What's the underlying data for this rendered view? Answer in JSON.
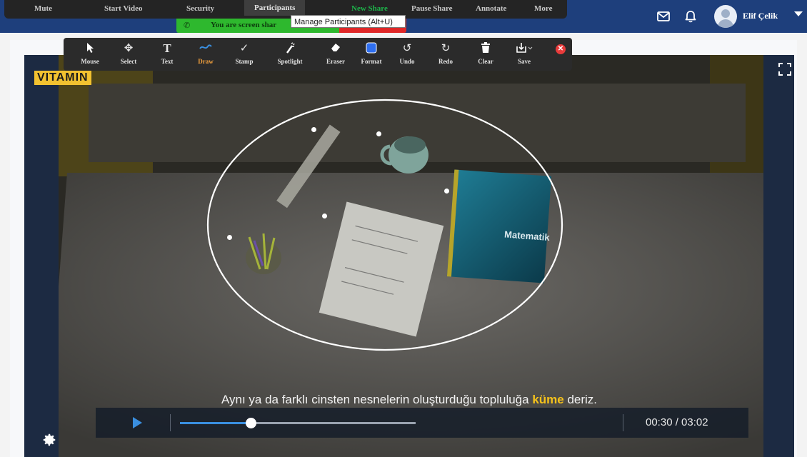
{
  "meeting_menu": [
    {
      "label": "Mute"
    },
    {
      "label": "Start Video"
    },
    {
      "label": "Security"
    },
    {
      "label": "Participants"
    },
    {
      "label": "New Share"
    },
    {
      "label": "Pause Share"
    },
    {
      "label": "Annotate"
    },
    {
      "label": "More"
    }
  ],
  "share_banner": {
    "text": "You are screen shar",
    "phone_icon": "phone-icon"
  },
  "tooltip": "Manage Participants (Alt+U)",
  "header": {
    "icons": [
      "mail-icon",
      "bell-icon"
    ],
    "user_name": "Elif Çelik"
  },
  "annotation_toolbar": [
    {
      "label": "Mouse",
      "icon": "cursor-icon"
    },
    {
      "label": "Select",
      "icon": "move-icon"
    },
    {
      "label": "Text",
      "icon": "text-icon"
    },
    {
      "label": "Draw",
      "icon": "draw-icon",
      "active": true
    },
    {
      "label": "Stamp",
      "icon": "check-icon"
    },
    {
      "label": "Spotlight",
      "icon": "spotlight-icon"
    },
    {
      "label": "Eraser",
      "icon": "eraser-icon"
    },
    {
      "label": "Format",
      "icon": "format-icon"
    },
    {
      "label": "Undo",
      "icon": "undo-icon"
    },
    {
      "label": "Redo",
      "icon": "redo-icon"
    },
    {
      "label": "Clear",
      "icon": "trash-icon"
    },
    {
      "label": "Save",
      "icon": "save-icon"
    }
  ],
  "video": {
    "logo": "VITAMIN",
    "book_title": "Matematik",
    "caption_before": "Aynı ya da farklı cinsten nesnelerin oluşturduğu topluluğa ",
    "caption_highlight": "küme",
    "caption_after": " deriz.",
    "time": "00:30 / 03:02",
    "progress": 0.166
  },
  "colors": {
    "header_bg": "#1e3f7c",
    "share_green": "#2eb82e",
    "stop_red": "#e02828",
    "active_orange": "#f2a03d",
    "accent_blue": "#3a8fe0",
    "highlight_yellow": "#f5c21b"
  }
}
